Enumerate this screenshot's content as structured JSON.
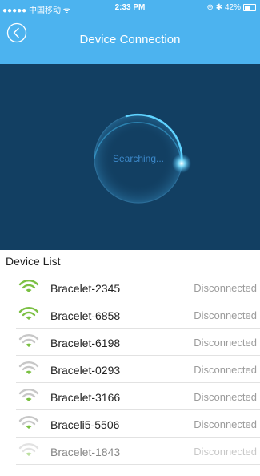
{
  "status_bar": {
    "carrier": "●●●●● 中国移动",
    "wifi_icon": "wifi-icon",
    "time": "2:33 PM",
    "right_icons": "⊕ ✱",
    "battery_text": "42%",
    "battery_level": 0.42
  },
  "header": {
    "back_icon": "chevron-left-circle-icon",
    "title": "Device Connection"
  },
  "search": {
    "status_text": "Searching..."
  },
  "device_list": {
    "heading": "Device List",
    "devices": [
      {
        "name": "Bracelet-2345",
        "status": "Disconnected",
        "signal": "strong",
        "color": "#7bc043"
      },
      {
        "name": "Bracelet-6858",
        "status": "Disconnected",
        "signal": "strong",
        "color": "#7bc043"
      },
      {
        "name": "Bracelet-6198",
        "status": "Disconnected",
        "signal": "weak",
        "color": "#7bc043"
      },
      {
        "name": "Bracelet-0293",
        "status": "Disconnected",
        "signal": "weak",
        "color": "#7bc043"
      },
      {
        "name": "Bracelet-3166",
        "status": "Disconnected",
        "signal": "weak",
        "color": "#7bc043"
      },
      {
        "name": "Braceli5-5506",
        "status": "Disconnected",
        "signal": "weak",
        "color": "#7bc043"
      },
      {
        "name": "Bracelet-1843",
        "status": "Disconnected",
        "signal": "weak",
        "color": "#7bc043"
      }
    ]
  },
  "colors": {
    "nav_blue": "#4cb3ef",
    "panel_navy": "#123f62",
    "radar_glow": "#5fd3ff",
    "signal_green": "#7bc043",
    "signal_grey": "#c7c7c7"
  }
}
